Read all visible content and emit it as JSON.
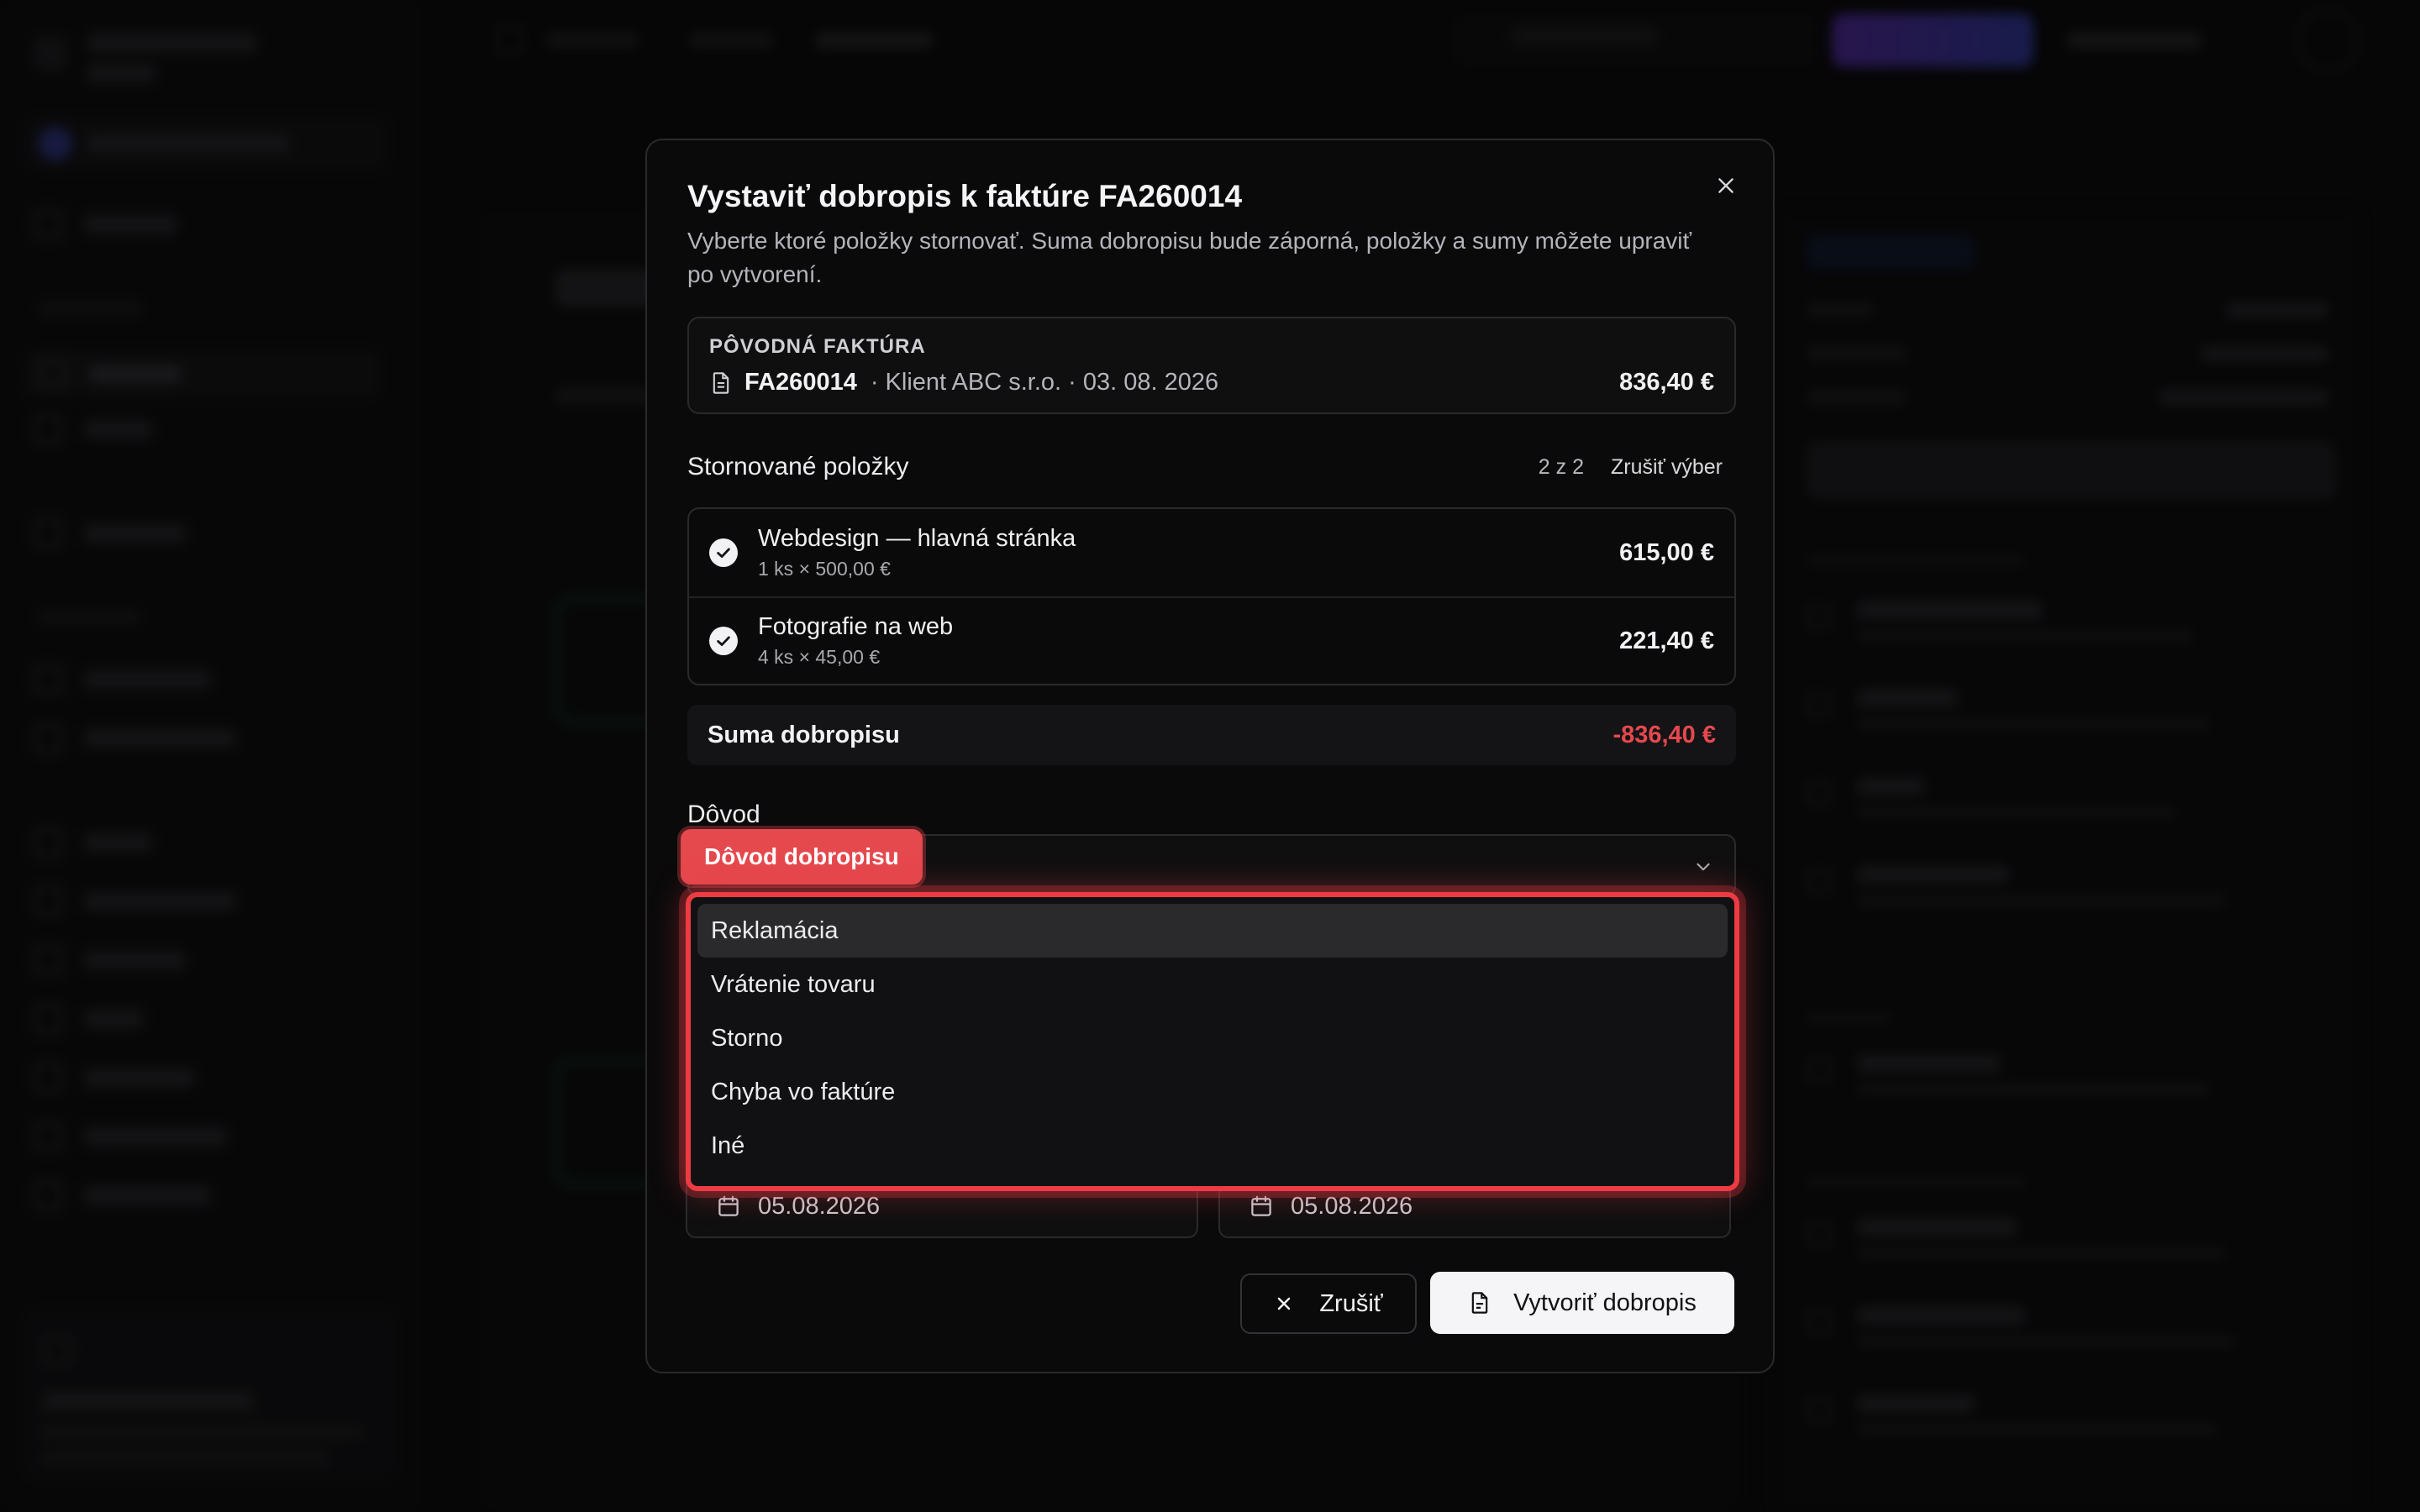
{
  "modal": {
    "title": "Vystaviť dobropis k faktúre FA260014",
    "description": "Vyberte ktoré položky stornovať. Suma dobropisu bude záporná, položky a sumy môžete upraviť po vytvorení.",
    "original_invoice": {
      "label": "PÔVODNÁ FAKTÚRA",
      "number": "FA260014",
      "meta": "· Klient ABC s.r.o. · 03. 08. 2026",
      "amount": "836,40 €"
    },
    "items_section": {
      "title": "Stornované položky",
      "count": "2 z 2",
      "clear_label": "Zrušiť výber",
      "items": [
        {
          "name": "Webdesign — hlavná stránka",
          "detail": "1 ks × 500,00 €",
          "amount": "615,00 €",
          "checked": true
        },
        {
          "name": "Fotografie na web",
          "detail": "4 ks × 45,00 €",
          "amount": "221,40 €",
          "checked": true
        }
      ]
    },
    "sum": {
      "label": "Suma dobropisu",
      "amount": "-836,40 €"
    },
    "reason": {
      "label": "Dôvod",
      "annotation": "Dôvod dobropisu",
      "options": [
        "Reklamácia",
        "Vrátenie tovaru",
        "Storno",
        "Chyba vo faktúre",
        "Iné"
      ],
      "highlighted_option": "Reklamácia"
    },
    "dates": {
      "left": "05.08.2026",
      "right": "05.08.2026"
    },
    "buttons": {
      "cancel": "Zrušiť",
      "create": "Vytvoriť dobropis"
    }
  },
  "colors": {
    "accent_red": "#e5484d",
    "modal_bg": "#0a0a0b",
    "primary_button_bg": "#f5f5f7"
  },
  "icons": {
    "close": "close-icon",
    "document": "document-icon",
    "check": "check-circle-icon",
    "chevron": "chevron-down-icon",
    "calendar": "calendar-icon",
    "cancel": "x-icon",
    "create": "file-icon"
  }
}
